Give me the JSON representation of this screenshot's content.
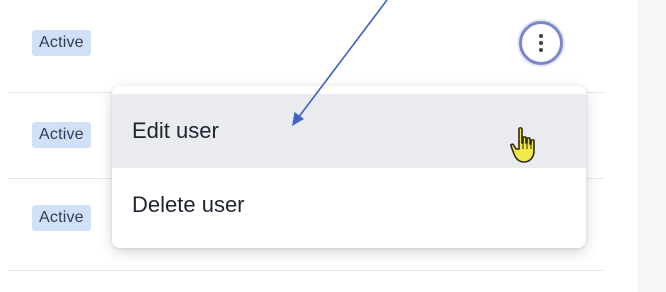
{
  "rows": [
    {
      "status": "Active"
    },
    {
      "status": "Active"
    },
    {
      "status": "Active"
    }
  ],
  "actions_menu": {
    "items": [
      {
        "label": "Edit user"
      },
      {
        "label": "Delete user"
      }
    ]
  },
  "icons": {
    "kebab": "more-vertical-icon",
    "cursor": "hand-pointer-icon"
  },
  "colors": {
    "badge_bg": "#cfe0f7",
    "badge_text": "#2d3e57",
    "menu_hover": "#e9ebef",
    "kebab_ring": "#7b86c9",
    "annotation_arrow": "#3f63c8",
    "cursor_fill": "#f2e84a"
  }
}
